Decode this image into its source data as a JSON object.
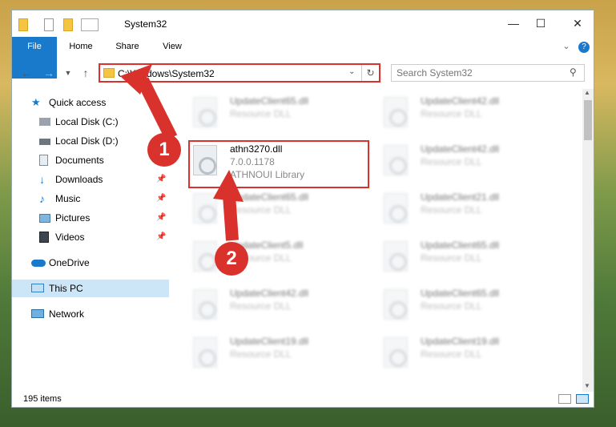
{
  "window": {
    "title": "System32"
  },
  "ribbon": {
    "tabs": [
      "File",
      "Home",
      "Share",
      "View"
    ]
  },
  "address": {
    "path": "C:\\Windows\\System32"
  },
  "search": {
    "placeholder": "Search System32"
  },
  "nav": {
    "items": [
      {
        "label": "Quick access",
        "icon": "star-icon"
      },
      {
        "label": "Local Disk (C:)",
        "icon": "drive-icon"
      },
      {
        "label": "Local Disk (D:)",
        "icon": "drive-icon"
      },
      {
        "label": "Documents",
        "icon": "documents-icon"
      },
      {
        "label": "Downloads",
        "icon": "download-icon"
      },
      {
        "label": "Music",
        "icon": "music-icon"
      },
      {
        "label": "Pictures",
        "icon": "pictures-icon"
      },
      {
        "label": "Videos",
        "icon": "videos-icon"
      },
      {
        "label": "OneDrive",
        "icon": "cloud-icon"
      },
      {
        "label": "This PC",
        "icon": "pc-icon"
      },
      {
        "label": "Network",
        "icon": "network-icon"
      }
    ]
  },
  "files": [
    {
      "name": "UpdateClient65.dll",
      "type": "Resource DLL"
    },
    {
      "name": "UpdateClient42.dll",
      "type": "Resource DLL"
    },
    {
      "name": "athn3270.dll",
      "version": "7.0.0.1178",
      "type": "ATHNOUI Library"
    },
    {
      "name": "UpdateClient42.dll",
      "type": "Resource DLL"
    },
    {
      "name": "UpdateClient65.dll",
      "type": "Resource DLL"
    },
    {
      "name": "UpdateClient21.dll",
      "type": "Resource DLL"
    },
    {
      "name": "UpdateClient5.dll",
      "type": "Resource DLL"
    },
    {
      "name": "UpdateClient65.dll",
      "type": "Resource DLL"
    },
    {
      "name": "UpdateClient42.dll",
      "type": "Resource DLL"
    },
    {
      "name": "UpdateClient65.dll",
      "type": "Resource DLL"
    },
    {
      "name": "UpdateClient19.dll",
      "type": "Resource DLL"
    },
    {
      "name": "UpdateClient19.dll",
      "type": "Resource DLL"
    }
  ],
  "status": {
    "items": "195 items"
  },
  "annotations": {
    "badge1": "1",
    "badge2": "2"
  },
  "colors": {
    "accent": "#1979ca",
    "highlight": "#d9312b"
  }
}
